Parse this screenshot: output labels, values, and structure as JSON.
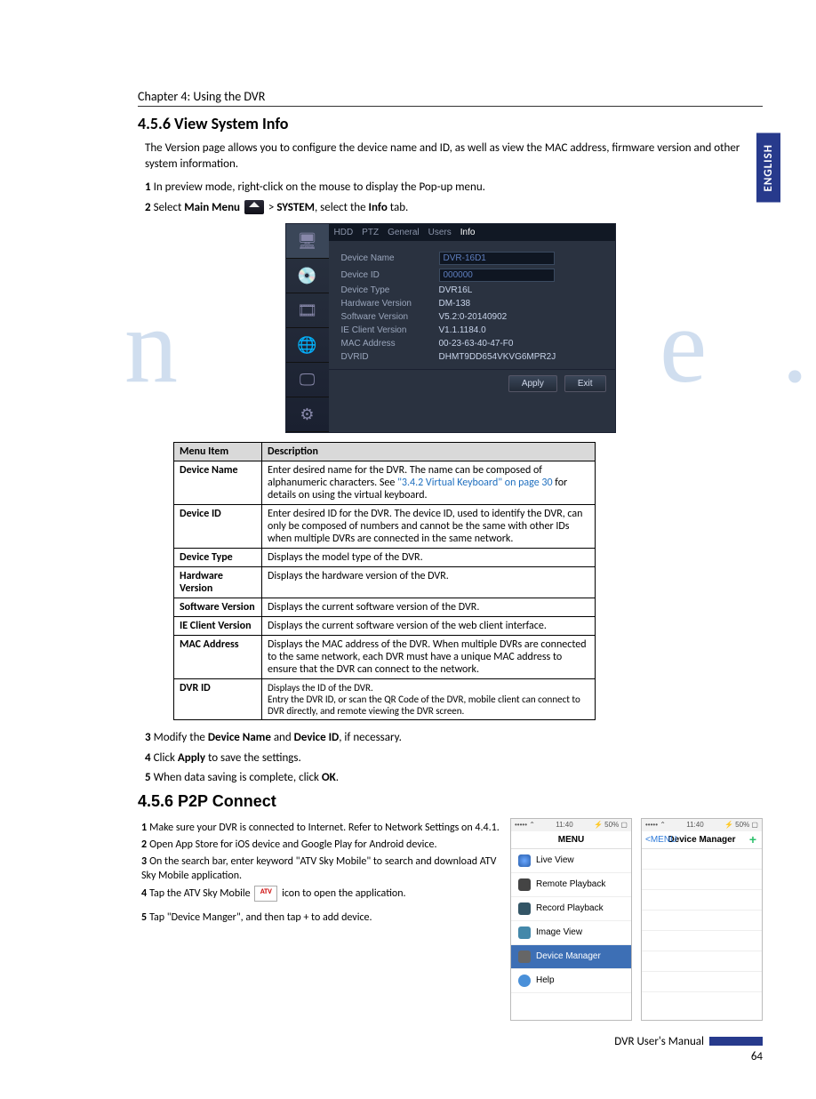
{
  "lang_tab": "ENGLISH",
  "chapter": "Chapter 4: Using the DVR",
  "s456": {
    "heading": "4.5.6  View System Info",
    "intro": "The Version page allows you to configure the device name and ID, as well as view the MAC address, firmware version and other system information.",
    "step1": "In preview mode, right-click on the mouse to display the Pop-up menu.",
    "step2_a": "Select ",
    "step2_mainmenu": "Main Menu",
    "step2_b": " > ",
    "step2_system": "SYSTEM",
    "step2_c": ", select the ",
    "step2_info": "Info",
    "step2_d": " tab."
  },
  "dvr": {
    "tabs": [
      "HDD",
      "PTZ",
      "General",
      "Users",
      "Info"
    ],
    "fields": {
      "device_name_lab": "Device Name",
      "device_name_val": "DVR-16D1",
      "device_id_lab": "Device ID",
      "device_id_val": "000000",
      "device_type_lab": "Device Type",
      "device_type_val": "DVR16L",
      "hw_lab": "Hardware Version",
      "hw_val": "DM-138",
      "sw_lab": "Software Version",
      "sw_val": "V5.2:0-20140902",
      "ie_lab": "IE Client Version",
      "ie_val": "V1.1.1184.0",
      "mac_lab": "MAC Address",
      "mac_val": "00-23-63-40-47-F0",
      "dvrid_lab": "DVRID",
      "dvrid_val": "DHMT9DD654VKVG6MPR2J"
    },
    "apply": "Apply",
    "exit": "Exit"
  },
  "table": {
    "col1": "Menu Item",
    "col2": "Description",
    "rows": [
      {
        "item": "Device Name",
        "desc_a": "Enter desired name for the DVR. The name can be composed of alphanumeric characters.  See ",
        "link": "\"3.4.2 Virtual Keyboard\" on page 30",
        "desc_b": " for details on using the virtual keyboard."
      },
      {
        "item": "Device ID",
        "desc": "Enter desired ID for the DVR. The device ID, used to identify the DVR, can only be composed of numbers and cannot be the same with other IDs when multiple DVRs are connected in the same network."
      },
      {
        "item": "Device Type",
        "desc": "Displays the model type of the DVR."
      },
      {
        "item": "Hardware Version",
        "desc": "Displays the hardware version of the DVR."
      },
      {
        "item": "Software Version",
        "desc": "Displays the current software version of the DVR."
      },
      {
        "item": "IE Client Version",
        "desc": "Displays the current software version of the web client interface."
      },
      {
        "item": "MAC Address",
        "desc": "Displays the MAC address of the DVR. When multiple DVRs are connected to the same network, each DVR must have a unique MAC address to ensure that the DVR can connect to the network."
      },
      {
        "item": "DVR ID",
        "desc": "Displays the ID of the DVR.\nEntry the DVR ID, or scan the QR Code of the DVR, mobile client can connect to DVR directly, and remote viewing the DVR screen."
      }
    ]
  },
  "post_steps": {
    "s3_a": "Modify the ",
    "s3_dn": "Device Name",
    "s3_b": " and ",
    "s3_di": "Device ID",
    "s3_c": ", if necessary.",
    "s4_a": "Click ",
    "s4_apply": "Apply",
    "s4_b": " to save the settings.",
    "s5_a": "When data saving is complete, click ",
    "s5_ok": "OK",
    "s5_b": "."
  },
  "p2p": {
    "heading": "4.5.6  P2P Connect",
    "s1": "Make sure your DVR is connected to Internet. Refer to Network Settings on 4.4.1.",
    "s2": "Open App Store for iOS device and Google Play for Android device.",
    "s3": "On the search bar, enter keyword \"ATV Sky Mobile\" to search and download ATV Sky Mobile application.",
    "s4_a": "Tap the ATV Sky Mobile ",
    "s4_b": " icon to open the application.",
    "s5": "Tap \"Device Manger\", and then tap + to add device."
  },
  "phone1": {
    "status_l": "•••••  ⌃",
    "status_time": "11:40",
    "status_r": "⚡ 50% ▢",
    "title": "MENU",
    "items": [
      "Live View",
      "Remote Playback",
      "Record Playback",
      "Image View",
      "Device Manager",
      "Help"
    ],
    "selected_index": 4
  },
  "phone2": {
    "status_l": "•••••  ⌃",
    "status_time": "11:40",
    "status_r": "⚡ 50% ▢",
    "back": "MENU",
    "title": "Device Manager",
    "plus": "+"
  },
  "footer": "DVR User's Manual",
  "page_no": "64",
  "atv_text": "ATV"
}
